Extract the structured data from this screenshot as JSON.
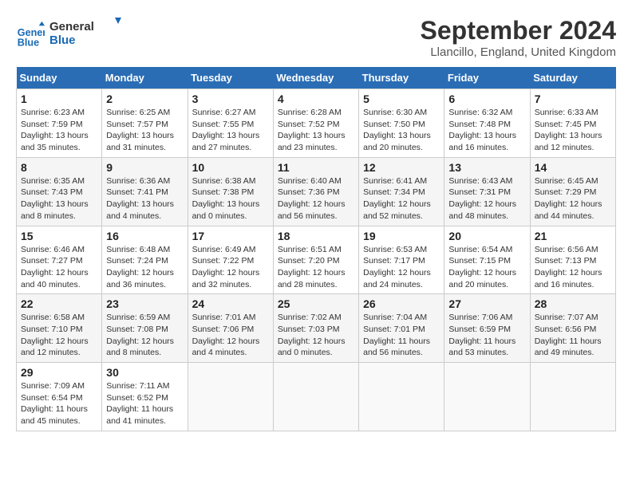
{
  "header": {
    "logo_line1": "General",
    "logo_line2": "Blue",
    "month_year": "September 2024",
    "location": "Llancillo, England, United Kingdom"
  },
  "days_of_week": [
    "Sunday",
    "Monday",
    "Tuesday",
    "Wednesday",
    "Thursday",
    "Friday",
    "Saturday"
  ],
  "weeks": [
    [
      {
        "day": "1",
        "sunrise": "6:23 AM",
        "sunset": "7:59 PM",
        "daylight": "13 hours and 35 minutes."
      },
      {
        "day": "2",
        "sunrise": "6:25 AM",
        "sunset": "7:57 PM",
        "daylight": "13 hours and 31 minutes."
      },
      {
        "day": "3",
        "sunrise": "6:27 AM",
        "sunset": "7:55 PM",
        "daylight": "13 hours and 27 minutes."
      },
      {
        "day": "4",
        "sunrise": "6:28 AM",
        "sunset": "7:52 PM",
        "daylight": "13 hours and 23 minutes."
      },
      {
        "day": "5",
        "sunrise": "6:30 AM",
        "sunset": "7:50 PM",
        "daylight": "13 hours and 20 minutes."
      },
      {
        "day": "6",
        "sunrise": "6:32 AM",
        "sunset": "7:48 PM",
        "daylight": "13 hours and 16 minutes."
      },
      {
        "day": "7",
        "sunrise": "6:33 AM",
        "sunset": "7:45 PM",
        "daylight": "13 hours and 12 minutes."
      }
    ],
    [
      {
        "day": "8",
        "sunrise": "6:35 AM",
        "sunset": "7:43 PM",
        "daylight": "13 hours and 8 minutes."
      },
      {
        "day": "9",
        "sunrise": "6:36 AM",
        "sunset": "7:41 PM",
        "daylight": "13 hours and 4 minutes."
      },
      {
        "day": "10",
        "sunrise": "6:38 AM",
        "sunset": "7:38 PM",
        "daylight": "13 hours and 0 minutes."
      },
      {
        "day": "11",
        "sunrise": "6:40 AM",
        "sunset": "7:36 PM",
        "daylight": "12 hours and 56 minutes."
      },
      {
        "day": "12",
        "sunrise": "6:41 AM",
        "sunset": "7:34 PM",
        "daylight": "12 hours and 52 minutes."
      },
      {
        "day": "13",
        "sunrise": "6:43 AM",
        "sunset": "7:31 PM",
        "daylight": "12 hours and 48 minutes."
      },
      {
        "day": "14",
        "sunrise": "6:45 AM",
        "sunset": "7:29 PM",
        "daylight": "12 hours and 44 minutes."
      }
    ],
    [
      {
        "day": "15",
        "sunrise": "6:46 AM",
        "sunset": "7:27 PM",
        "daylight": "12 hours and 40 minutes."
      },
      {
        "day": "16",
        "sunrise": "6:48 AM",
        "sunset": "7:24 PM",
        "daylight": "12 hours and 36 minutes."
      },
      {
        "day": "17",
        "sunrise": "6:49 AM",
        "sunset": "7:22 PM",
        "daylight": "12 hours and 32 minutes."
      },
      {
        "day": "18",
        "sunrise": "6:51 AM",
        "sunset": "7:20 PM",
        "daylight": "12 hours and 28 minutes."
      },
      {
        "day": "19",
        "sunrise": "6:53 AM",
        "sunset": "7:17 PM",
        "daylight": "12 hours and 24 minutes."
      },
      {
        "day": "20",
        "sunrise": "6:54 AM",
        "sunset": "7:15 PM",
        "daylight": "12 hours and 20 minutes."
      },
      {
        "day": "21",
        "sunrise": "6:56 AM",
        "sunset": "7:13 PM",
        "daylight": "12 hours and 16 minutes."
      }
    ],
    [
      {
        "day": "22",
        "sunrise": "6:58 AM",
        "sunset": "7:10 PM",
        "daylight": "12 hours and 12 minutes."
      },
      {
        "day": "23",
        "sunrise": "6:59 AM",
        "sunset": "7:08 PM",
        "daylight": "12 hours and 8 minutes."
      },
      {
        "day": "24",
        "sunrise": "7:01 AM",
        "sunset": "7:06 PM",
        "daylight": "12 hours and 4 minutes."
      },
      {
        "day": "25",
        "sunrise": "7:02 AM",
        "sunset": "7:03 PM",
        "daylight": "12 hours and 0 minutes."
      },
      {
        "day": "26",
        "sunrise": "7:04 AM",
        "sunset": "7:01 PM",
        "daylight": "11 hours and 56 minutes."
      },
      {
        "day": "27",
        "sunrise": "7:06 AM",
        "sunset": "6:59 PM",
        "daylight": "11 hours and 53 minutes."
      },
      {
        "day": "28",
        "sunrise": "7:07 AM",
        "sunset": "6:56 PM",
        "daylight": "11 hours and 49 minutes."
      }
    ],
    [
      {
        "day": "29",
        "sunrise": "7:09 AM",
        "sunset": "6:54 PM",
        "daylight": "11 hours and 45 minutes."
      },
      {
        "day": "30",
        "sunrise": "7:11 AM",
        "sunset": "6:52 PM",
        "daylight": "11 hours and 41 minutes."
      },
      null,
      null,
      null,
      null,
      null
    ]
  ]
}
